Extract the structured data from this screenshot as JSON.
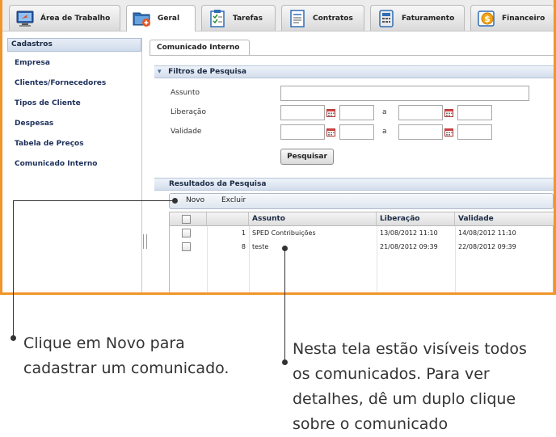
{
  "tabs": [
    {
      "label": "Área de Trabalho",
      "icon": "desktop-icon"
    },
    {
      "label": "Geral",
      "icon": "folder-add-icon"
    },
    {
      "label": "Tarefas",
      "icon": "checklist-icon"
    },
    {
      "label": "Contratos",
      "icon": "document-icon"
    },
    {
      "label": "Faturamento",
      "icon": "calculator-icon"
    },
    {
      "label": "Financeiro",
      "icon": "money-icon"
    }
  ],
  "active_tab": "Geral",
  "sidebar": {
    "header": "Cadastros",
    "items": [
      "Empresa",
      "Clientes/Fornecedores",
      "Tipos de Cliente",
      "Despesas",
      "Tabela de Preços",
      "Comunicado Interno"
    ]
  },
  "content": {
    "tab_label": "Comunicado Interno",
    "filters": {
      "title": "Filtros de Pesquisa",
      "assunto_label": "Assunto",
      "liberacao_label": "Liberação",
      "validade_label": "Validade",
      "between": "a",
      "search_button": "Pesquisar"
    },
    "results": {
      "title": "Resultados da Pesquisa",
      "new_button": "Novo",
      "delete_button": "Excluir",
      "columns": [
        "Assunto",
        "Liberação",
        "Validade"
      ],
      "rows": [
        {
          "id": "1",
          "assunto": "SPED Contribuições",
          "liberacao": "13/08/2012 11:10",
          "validade": "14/08/2012 11:10"
        },
        {
          "id": "8",
          "assunto": "teste",
          "liberacao": "21/08/2012 09:39",
          "validade": "22/08/2012 09:39"
        }
      ]
    }
  },
  "notes": {
    "left": [
      "Clique em Novo para",
      "cadastrar um comunicado."
    ],
    "right": [
      "Nesta tela estão visíveis todos",
      "os comunicados. Para ver",
      "detalhes, dê um duplo clique",
      "sobre o comunicado"
    ]
  },
  "colors": {
    "highlight_border": "#f0952a",
    "accent_blue": "#1c2f5a"
  }
}
